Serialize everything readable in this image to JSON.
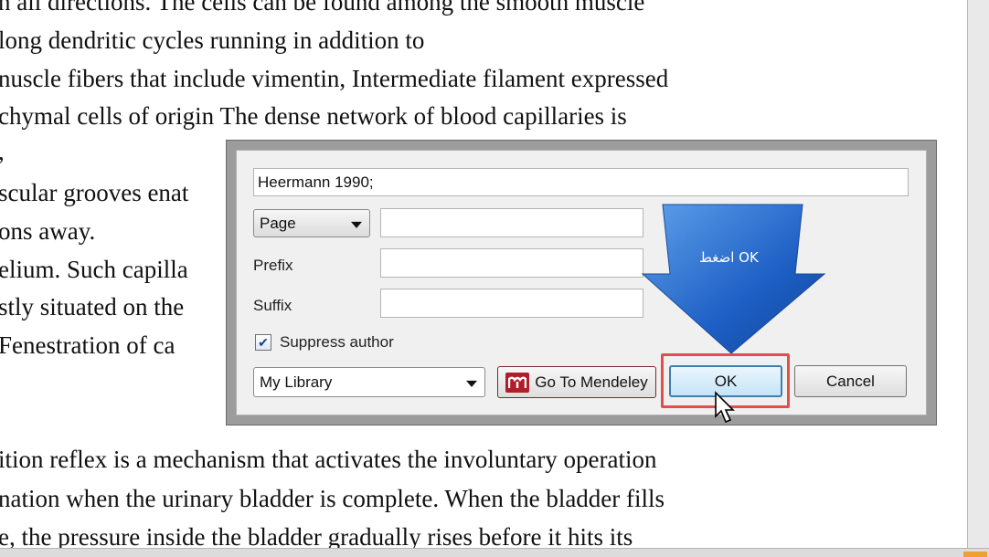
{
  "document": {
    "lines": [
      "n all directions. The cells can be found among the smooth muscle",
      " long dendritic cycles running in addition to",
      "nuscle fibers that include vimentin, Intermediate filament expressed",
      "chymal cells of origin The dense network of blood capillaries is",
      ",",
      "scular grooves enat",
      "ons away.",
      "elium. Such capilla",
      "stly situated on the",
      "  Fenestration of ca",
      "ition reflex is a mechanism that activates the involuntary operation",
      "nation when the urinary bladder is complete. When the bladder fills",
      "e, the pressure inside the bladder gradually rises before it hits its"
    ]
  },
  "dialog": {
    "citation_value": "Heermann 1990;",
    "locator_select": "Page",
    "locator_value": "",
    "prefix_label": "Prefix",
    "prefix_value": "",
    "suffix_label": "Suffix",
    "suffix_value": "",
    "suppress_author_label": "Suppress author",
    "suppress_author_checked": true,
    "library_select": "My Library",
    "goto_mendeley_label": "Go To Mendeley",
    "ok_label": "OK",
    "cancel_label": "Cancel"
  },
  "annotation": {
    "callout_text": "اضغط OK",
    "callout_color": "#1d5fc4",
    "highlight_color": "#e0504a"
  },
  "icons": {
    "dropdown": "chevron-down-icon",
    "checkbox": "checkmark-icon",
    "mendeley": "mendeley-logo-icon",
    "cursor": "mouse-pointer-icon"
  }
}
